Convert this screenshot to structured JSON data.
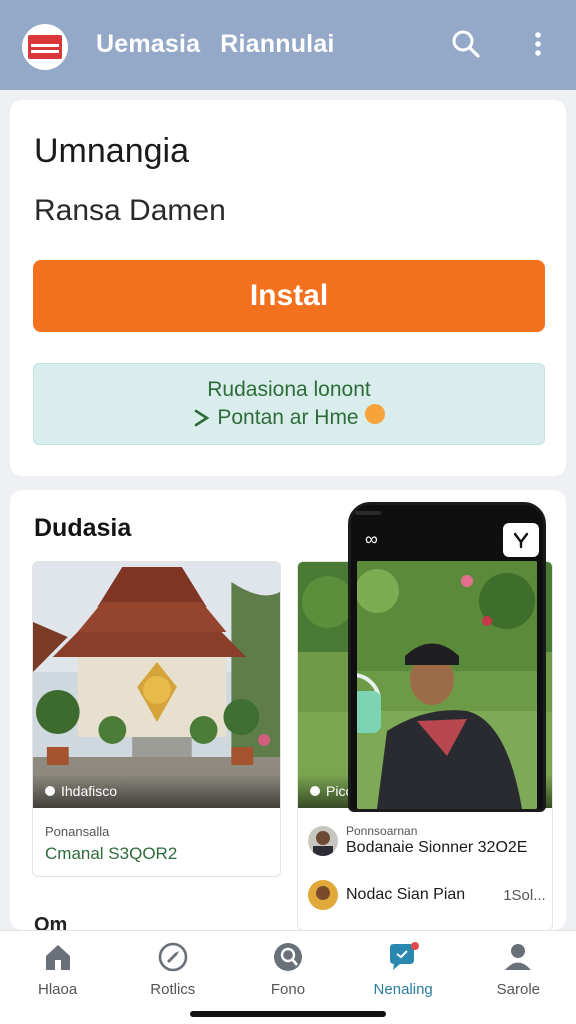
{
  "appbar": {
    "title_part1": "Uemasia",
    "title_part2": "Riannulai",
    "logo_icon": "flag-logo",
    "search_icon": "search-icon",
    "more_icon": "more-vertical-icon",
    "color": "#94a8c8"
  },
  "install_card": {
    "app_name": "Umnangia",
    "publisher": "Ransa Damen",
    "install_label": "Instal",
    "install_color": "#f3701f",
    "banner_line1": "Rudasiona lonont",
    "banner_line2": "Pontan ar Hme",
    "banner_icon": "download-arrow-icon"
  },
  "gallery": {
    "title": "Dudasia",
    "left_tile": {
      "caption": "Ihdafisco",
      "sub": "Ponansalla",
      "price": "Cmanal S3QOR2"
    },
    "right_tile": {
      "caption": "Picco ciadere",
      "row1_sub": "Ponnsoarnan",
      "row1_main": "Bodanaie Sionner 32O2E",
      "row2_main": "Nodac Sian Pian",
      "row2_count": "1Sol..."
    },
    "phone_corner_label": "q́"
  },
  "peek_text": "Om",
  "bottom_nav": [
    {
      "label": "Hlaoa",
      "icon": "home-icon"
    },
    {
      "label": "Rotlics",
      "icon": "compass-icon"
    },
    {
      "label": "Fono",
      "icon": "profile-search-icon"
    },
    {
      "label": "Nenaling",
      "icon": "chat-icon",
      "active": true
    },
    {
      "label": "Sarole",
      "icon": "person-icon"
    }
  ],
  "active_color": "#2a7d9c"
}
